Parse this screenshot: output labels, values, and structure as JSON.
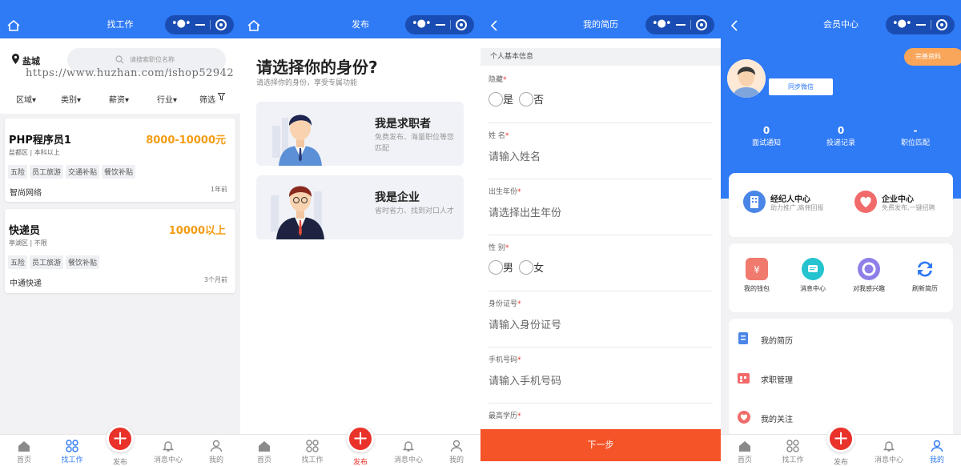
{
  "panel1": {
    "nav_title": "找工作",
    "city": "盐城",
    "search_placeholder": "请搜索职位名称",
    "watermark": "https://www.huzhan.com/ishop52942",
    "filters": [
      "区域▾",
      "类别▾",
      "薪资▾",
      "行业▾",
      "筛选"
    ],
    "jobs": [
      {
        "title": "PHP程序员1",
        "salary": "8000-10000元",
        "sub": "盐都区 | 本科以上",
        "tags": [
          "五险",
          "员工旅游",
          "交通补贴",
          "餐饮补贴"
        ],
        "company": "智尚网络",
        "time": "1年前"
      },
      {
        "title": "快递员",
        "salary": "10000以上",
        "sub": "亭湖区 | 不限",
        "tags": [
          "五险",
          "员工旅游",
          "餐饮补贴"
        ],
        "company": "中通快递",
        "time": "3个月前"
      }
    ]
  },
  "panel2": {
    "nav_title": "发布",
    "question": "请选择你的身份?",
    "question_sub": "请选择你的身份，享受专属功能",
    "options": [
      {
        "title": "我是求职者",
        "desc": "免费发布、海量职位等您匹配"
      },
      {
        "title": "我是企业",
        "desc": "省时省力、找到对口人才"
      }
    ]
  },
  "panel3": {
    "nav_title": "我的简历",
    "section": "个人基本信息",
    "hidden_label": "隐藏",
    "hidden_options": [
      "是",
      "否"
    ],
    "name_label": "姓 名",
    "name_placeholder": "请输入姓名",
    "birth_label": "出生年份",
    "birth_placeholder": "请选择出生年份",
    "gender_label": "性 别",
    "gender_options": [
      "男",
      "女"
    ],
    "id_label": "身份证号",
    "id_placeholder": "请输入身份证号",
    "phone_label": "手机号码",
    "phone_placeholder": "请输入手机号码",
    "edu_label": "最高学历",
    "required_mark": "*",
    "next": "下一步"
  },
  "panel4": {
    "nav_title": "会员中心",
    "complete": "完善资料",
    "sync": "同步微信",
    "stats": [
      {
        "n": "0",
        "l": "面试通知"
      },
      {
        "n": "0",
        "l": "投递记录"
      },
      {
        "n": "-",
        "l": "职位匹配"
      }
    ],
    "entries": [
      {
        "t": "经纪人中心",
        "d": "助力推广,高佣回报"
      },
      {
        "t": "企业中心",
        "d": "免费发布,一键招聘"
      }
    ],
    "tools": [
      "我的钱包",
      "消息中心",
      "对我感兴趣",
      "刷新简历"
    ],
    "list": [
      "我的简历",
      "求职管理",
      "我的关注"
    ]
  },
  "tabbar": {
    "items": [
      "首页",
      "找工作",
      "发布",
      "消息中心",
      "我的"
    ]
  },
  "colors": {
    "primary": "#2f7af5",
    "accent": "#e9322a",
    "salary": "#f39c12",
    "next": "#f55428"
  }
}
